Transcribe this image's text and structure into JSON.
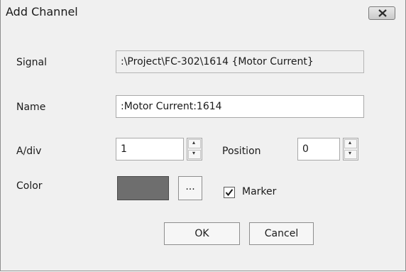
{
  "window": {
    "title": "Add Channel",
    "close_icon": "close-icon"
  },
  "signal": {
    "label": "Signal",
    "value": ":\\Project\\FC-302\\1614 {Motor Current}"
  },
  "name": {
    "label": "Name",
    "value": ":Motor Current:1614"
  },
  "adiv": {
    "label": "A/div",
    "value": "1"
  },
  "position": {
    "label": "Position",
    "value": "0"
  },
  "color": {
    "label": "Color",
    "swatch": "#6e6e6e",
    "picker_label": "..."
  },
  "marker": {
    "label": "Marker",
    "checked": true
  },
  "buttons": {
    "ok": "OK",
    "cancel": "Cancel"
  }
}
